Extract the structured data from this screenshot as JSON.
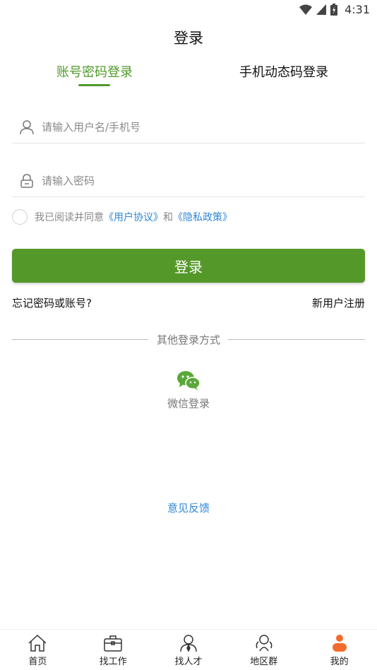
{
  "status_bar": {
    "time": "4:31"
  },
  "header": {
    "title": "登录"
  },
  "tabs": [
    {
      "label": "账号密码登录",
      "active": true
    },
    {
      "label": "手机动态码登录",
      "active": false
    }
  ],
  "form": {
    "username_placeholder": "请输入用户名/手机号",
    "password_placeholder": "请输入密码"
  },
  "agreement": {
    "prefix": "我已阅读并同意",
    "user_agreement": "《用户协议》",
    "and": "和",
    "privacy_policy": "《隐私政策》"
  },
  "login_button": "登录",
  "links": {
    "forgot": "忘记密码或账号?",
    "register": "新用户注册"
  },
  "other_login": {
    "divider": "其他登录方式",
    "wechat_label": "微信登录"
  },
  "feedback": "意见反馈",
  "bottom_nav": [
    {
      "label": "首页",
      "icon": "home-icon"
    },
    {
      "label": "找工作",
      "icon": "briefcase-icon"
    },
    {
      "label": "找人才",
      "icon": "person-icon"
    },
    {
      "label": "地区群",
      "icon": "group-icon"
    },
    {
      "label": "我的",
      "icon": "profile-icon",
      "active": true
    }
  ],
  "colors": {
    "brand_green": "#55982a",
    "link_blue": "#2d87d8",
    "profile_orange": "#f26b2c"
  }
}
